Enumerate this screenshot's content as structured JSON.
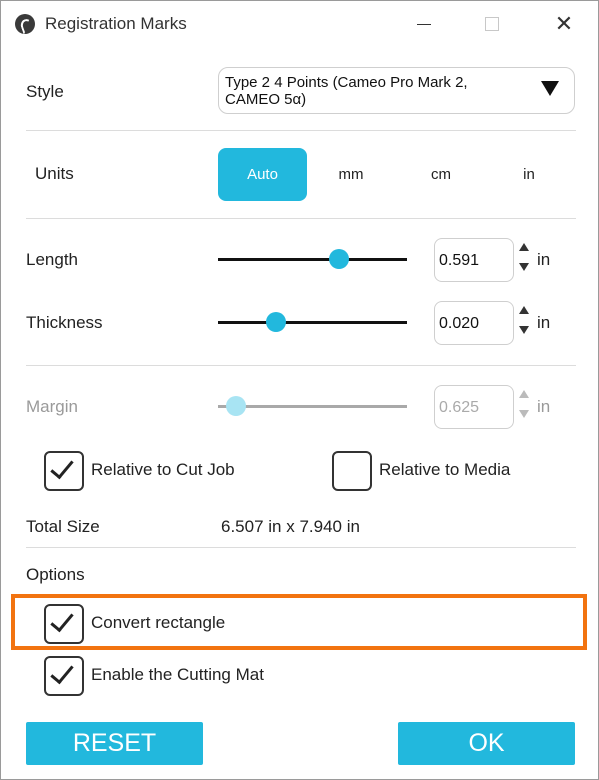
{
  "window": {
    "title": "Registration Marks",
    "close_glyph": "✕"
  },
  "style": {
    "label": "Style",
    "selected": "Type 2 4 Points (Cameo Pro Mark 2, CAMEO 5α)"
  },
  "units": {
    "label": "Units",
    "options": [
      "Auto",
      "mm",
      "cm",
      "in"
    ],
    "active": "Auto"
  },
  "length": {
    "label": "Length",
    "value": "0.591",
    "unit": "in",
    "slider_fraction": 0.64
  },
  "thickness": {
    "label": "Thickness",
    "value": "0.020",
    "unit": "in",
    "slider_fraction": 0.3
  },
  "margin": {
    "label": "Margin",
    "value": "0.625",
    "unit": "in",
    "slider_fraction": 0.09,
    "enabled": false
  },
  "relative": {
    "cut_job": {
      "label": "Relative to Cut Job",
      "checked": true
    },
    "media": {
      "label": "Relative to Media",
      "checked": false
    }
  },
  "total_size": {
    "label": "Total Size",
    "value": "6.507 in x 7.940 in"
  },
  "options": {
    "label": "Options",
    "convert_rectangle": {
      "label": "Convert rectangle",
      "checked": true
    },
    "enable_cutting_mat": {
      "label": "Enable the Cutting Mat",
      "checked": true
    }
  },
  "buttons": {
    "reset": "RESET",
    "ok": "OK"
  },
  "colors": {
    "accent": "#22b8dd",
    "highlight": "#f27310"
  },
  "icons": {
    "app": "silhouette-logo-icon",
    "dropdown": "triangle-down-icon",
    "spin_up": "triangle-up-icon",
    "spin_down": "triangle-down-icon",
    "check": "checkmark-icon"
  }
}
